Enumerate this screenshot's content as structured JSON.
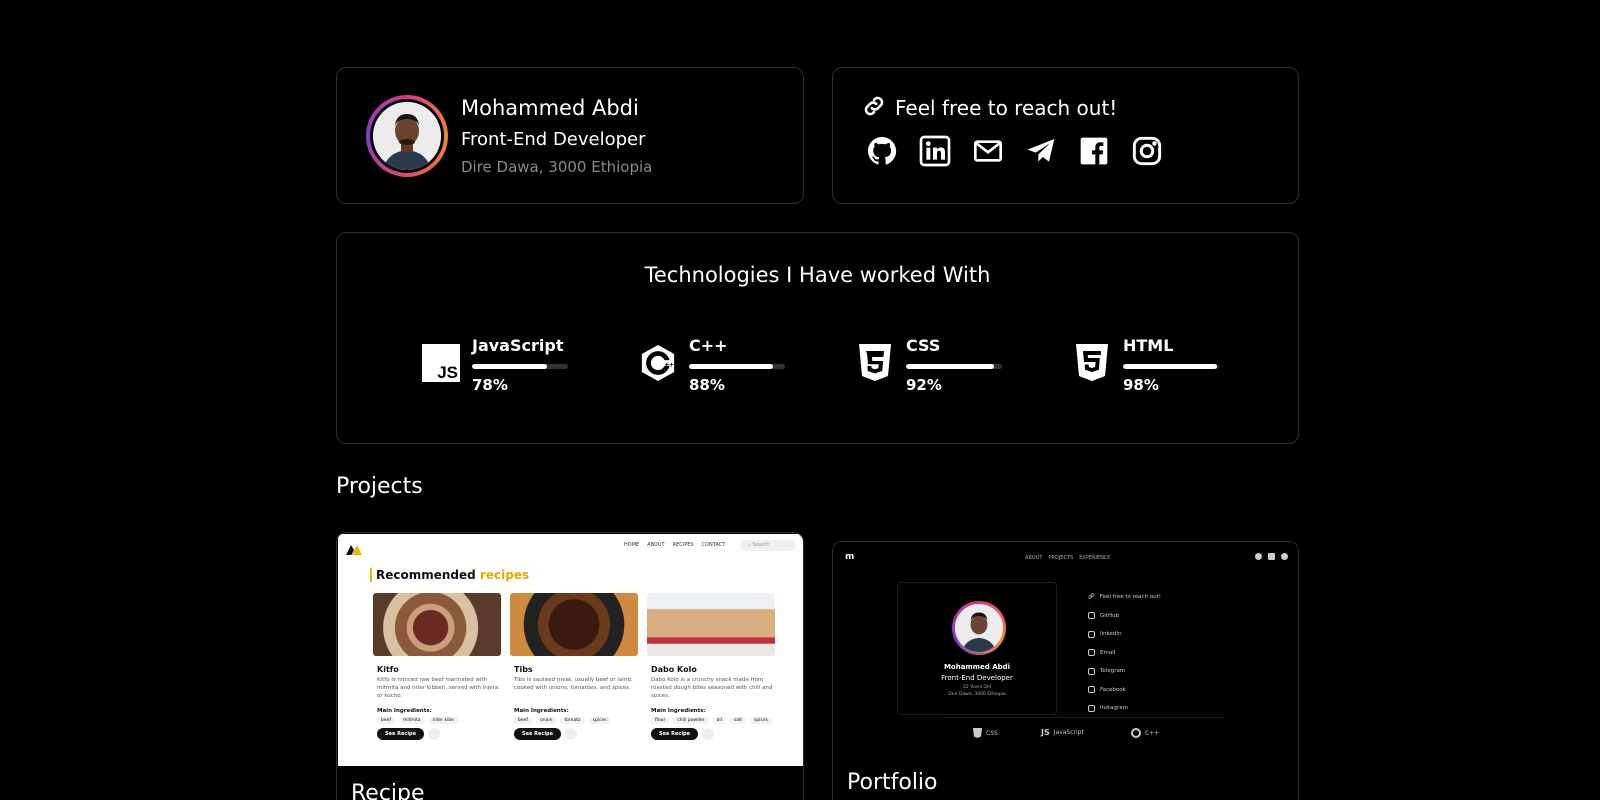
{
  "profile": {
    "name": "Mohammed Abdi",
    "role": "Front-End Developer",
    "location": "Dire Dawa, 3000 Ethiopia"
  },
  "contact": {
    "title": "Feel free to reach out!",
    "links": [
      {
        "icon": "github-icon"
      },
      {
        "icon": "linkedin-icon"
      },
      {
        "icon": "email-icon"
      },
      {
        "icon": "telegram-icon"
      },
      {
        "icon": "facebook-icon"
      },
      {
        "icon": "instagram-icon"
      }
    ]
  },
  "technologies": {
    "title": "Technologies I Have worked With",
    "items": [
      {
        "name": "JavaScript",
        "percent": "78%",
        "value": 0.78,
        "icon": "javascript-icon"
      },
      {
        "name": "C++",
        "percent": "88%",
        "value": 0.88,
        "icon": "cpp-icon"
      },
      {
        "name": "CSS",
        "percent": "92%",
        "value": 0.92,
        "icon": "css3-icon"
      },
      {
        "name": "HTML",
        "percent": "98%",
        "value": 0.98,
        "icon": "html5-icon"
      }
    ]
  },
  "projects": {
    "heading": "Projects",
    "items": [
      {
        "title": "Recipe",
        "preview": {
          "nav": [
            "HOME",
            "ABOUT",
            "RECIPES",
            "CONTACT"
          ],
          "search_placeholder": "Search",
          "heading_prefix": "Recommended",
          "heading_accent": "recipes",
          "ingredients_label": "Main Ingredients:",
          "button_label": "See Recipe",
          "cards": [
            {
              "name": "Kitfo",
              "desc": "Kitfo is minced raw beef marinated with mitmita and niter kibbeh, served with injera or kocho.",
              "tags": [
                "beef",
                "mitmita",
                "niter kibe"
              ]
            },
            {
              "name": "Tibs",
              "desc": "Tibs is sautéed meat, usually beef or lamb, cooked with onions, tomatoes, and spices.",
              "tags": [
                "beef",
                "onion",
                "tomato",
                "spices"
              ]
            },
            {
              "name": "Dabo Kolo",
              "desc": "Dabo Kolo is a crunchy snack made from roasted dough bites seasoned with chili and spices.",
              "tags": [
                "flour",
                "chili powder",
                "oil",
                "salt",
                "spices"
              ]
            }
          ]
        }
      },
      {
        "title": "Portfolio",
        "preview": {
          "nav": [
            "ABOUT",
            "PROJECTS",
            "EXPERIENCE"
          ],
          "name": "Mohammed Abdi",
          "role": "Front-End Developer",
          "age": "22 Years Old",
          "location": "Dire Dawa, 3000 Ethiopia",
          "reach_title": "Feel free to reach out!",
          "links": [
            "GitHub",
            "linkedIn",
            "Email",
            "Telegram",
            "Facebook",
            "Instagram"
          ],
          "techs": [
            "CSS",
            "JavaScript",
            "C++"
          ]
        }
      }
    ]
  }
}
